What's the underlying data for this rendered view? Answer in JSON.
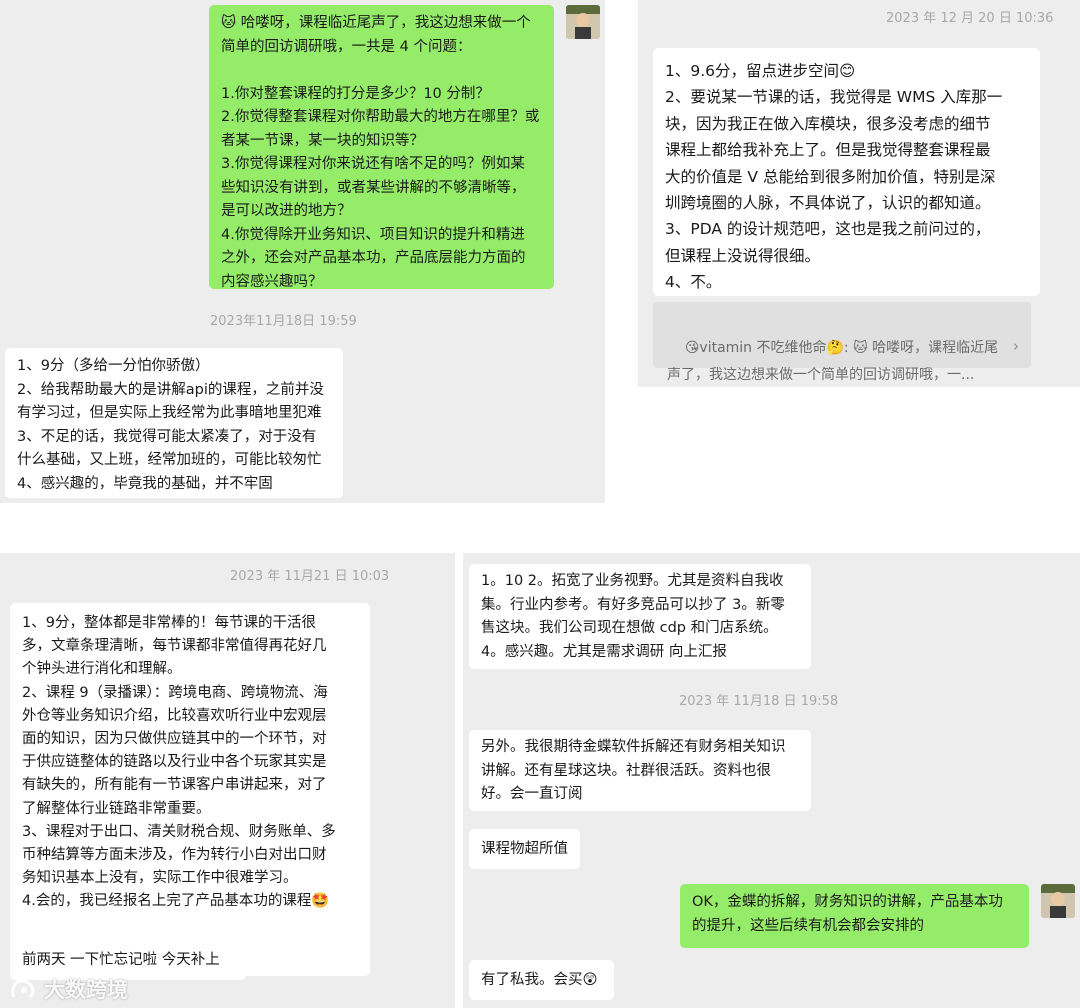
{
  "panel1": {
    "question": "🐱 哈喽呀，课程临近尾声了，我这边想来做一个\n简单的回访调研哦，一共是 4 个问题：\n\n1.你对整套课程的打分是多少？10 分制？\n2.你觉得整套课程对你帮助最大的地方在哪里？或\n者某一节课，某一块的知识等？\n3.你觉得课程对你来说还有啥不足的吗？例如某\n些知识没有讲到，或者某些讲解的不够清晰等，\n是可以改进的地方？\n4.你觉得除开业务知识、项目知识的提升和精进\n之外，还会对产品基本功，产品底层能力方面的\n内容感兴趣吗？",
    "timestamp": "2023年11月18日 19:59",
    "reply": "1、9分（多给一分怕你骄傲）\n2、给我帮助最大的是讲解api的课程，之前并没\n有学习过，但是实际上我经常为此事暗地里犯难\n3、不足的话，我觉得可能太紧凑了，对于没有\n什么基础，又上班，经常加班的，可能比较匆忙\n4、感兴趣的，毕竟我的基础，并不牢固"
  },
  "panel2": {
    "timestamp": "2023 年 12 月 20 日 10:36",
    "reply": "1、9.6分，留点进步空间😊\n2、要说某一节课的话，我觉得是 WMS 入库那一\n块，因为我正在做入库模块，很多没考虑的细节\n课程上都给我补充上了。但是我觉得整套课程最\n大的价值是 V 总能给到很多附加价值，特别是深\n圳跨境圈的人脉，不具体说了，认识的都知道。\n3、PDA 的设计规范吧，这也是我之前问过的，\n但课程上没说得很细。\n4、不。",
    "quote": "😘vitamin 不吃维他命🤔: 🐱 哈喽呀，课程临近尾\n声了，我这边想来做一个简单的回访调研哦，一...",
    "quote_chevron": "›"
  },
  "panel3": {
    "timestamp": "2023 年 11月21 日 10:03",
    "reply": "1、9分，整体都是非常棒的！每节课的干活很\n多，文章条理清晰，每节课都非常值得再花好几\n个钟头进行消化和理解。\n2、课程 9（录播课）：跨境电商、跨境物流、海\n外仓等业务知识介绍，比较喜欢听行业中宏观层\n面的知识，因为只做供应链其中的一个环节，对\n于供应链整体的链路以及行业中各个玩家其实是\n有缺失的，所有能有一节课客户串讲起来，对了\n了解整体行业链路非常重要。\n3、课程对于出口、清关财税合规、财务账单、多\n币种结算等方面未涉及，作为转行小白对出口财\n务知识基本上没有，实际工作中很难学习。\n4.会的，我已经报名上完了产品基本功的课程🤩",
    "reply2": "前两天 一下忙忘记啦 今天补上"
  },
  "panel4": {
    "msg1": "1。10 2。拓宽了业务视野。尤其是资料自我收\n集。行业内参考。有好多竞品可以抄了 3。新零\n售这块。我们公司现在想做 cdp 和门店系统。\n4。感兴趣。尤其是需求调研 向上汇报",
    "timestamp": "2023 年 11月18 日 19:58",
    "msg2": "另外。我很期待金蝶软件拆解还有财务相关知识\n讲解。还有星球这块。社群很活跃。资料也很\n好。会一直订阅",
    "msg3": "课程物超所值",
    "msg4": "OK，金蝶的拆解，财务知识的讲解，产品基本功\n的提升，这些后续有机会都会安排的",
    "msg5": "有了私我。会买😲"
  },
  "watermark": {
    "text": "大数跨境"
  },
  "colors": {
    "panel_bg": "#ededed",
    "bubble_green": "#95ec69",
    "bubble_white": "#ffffff",
    "timestamp": "#a8a8a8"
  }
}
